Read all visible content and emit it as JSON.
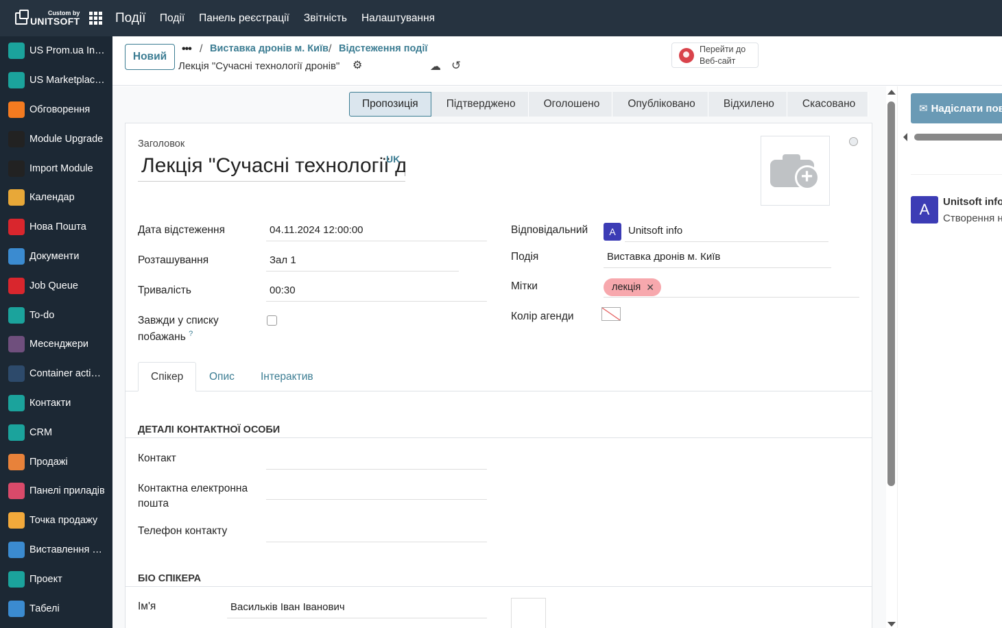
{
  "brand": {
    "small": "Custom by",
    "big": "UNITSOFT"
  },
  "navbar": {
    "app_title": "Події",
    "menu": [
      "Події",
      "Панель реєстрації",
      "Звітність",
      "Налаштування"
    ]
  },
  "sidebar": {
    "items": [
      {
        "label": "US Prom.ua Inte...",
        "icon": "cube-icon",
        "color": "#1ba39c"
      },
      {
        "label": "US Marketplace...",
        "icon": "cube-icon",
        "color": "#1ba39c"
      },
      {
        "label": "Обговорення",
        "icon": "chat-bubble-icon",
        "color": "#f47b20"
      },
      {
        "label": "Module Upgrade",
        "icon": "upgrade-icon",
        "color": "#222222"
      },
      {
        "label": "Import Module",
        "icon": "import-icon",
        "color": "#222222"
      },
      {
        "label": "Календар",
        "icon": "calendar-icon",
        "color": "#e8a838"
      },
      {
        "label": "Нова Пошта",
        "icon": "nova-poshta-icon",
        "color": "#d9262d"
      },
      {
        "label": "Документи",
        "icon": "documents-icon",
        "color": "#3b8bd0"
      },
      {
        "label": "Job Queue",
        "icon": "job-queue-icon",
        "color": "#d9262d"
      },
      {
        "label": "To-do",
        "icon": "todo-icon",
        "color": "#1ba39c"
      },
      {
        "label": "Месенджери",
        "icon": "messenger-icon",
        "color": "#6f4f7d"
      },
      {
        "label": "Container actions",
        "icon": "container-icon",
        "color": "#2d4a6b"
      },
      {
        "label": "Контакти",
        "icon": "contacts-icon",
        "color": "#1ba39c"
      },
      {
        "label": "CRM",
        "icon": "crm-icon",
        "color": "#1ba39c"
      },
      {
        "label": "Продажі",
        "icon": "sales-icon",
        "color": "#e8823a"
      },
      {
        "label": "Панелі приладів",
        "icon": "dashboard-icon",
        "color": "#d94a6a"
      },
      {
        "label": "Точка продажу",
        "icon": "pos-icon",
        "color": "#f2a93b"
      },
      {
        "label": "Виставлення ра...",
        "icon": "invoice-icon",
        "color": "#3b8bd0"
      },
      {
        "label": "Проект",
        "icon": "project-icon",
        "color": "#1ba39c"
      },
      {
        "label": "Табелі",
        "icon": "timesheet-icon",
        "color": "#3b8bd0"
      }
    ]
  },
  "control": {
    "new_label": "Новий",
    "dots": "•••",
    "breadcrumb": [
      "Виставка дронів м. Київ",
      "Відстеження події"
    ],
    "current": "Лекція \"Сучасні технології дронів\"",
    "website_label_1": "Перейти до",
    "website_label_2": "Веб-сайт"
  },
  "stages": [
    "Пропозиція",
    "Підтверджено",
    "Оголошено",
    "Опубліковано",
    "Відхилено",
    "Скасовано"
  ],
  "form": {
    "title_label": "Заголовок",
    "title_value": "Лекція \"Сучасні технології дронів\"",
    "lang_badge": "UK",
    "date_label": "Дата відстеження",
    "date_value": "04.11.2024 12:00:00",
    "location_label": "Розташування",
    "location_value": "Зал 1",
    "duration_label": "Тривалість",
    "duration_value": "00:30",
    "wishlist_label_1": "Завжди у списку",
    "wishlist_label_2": "побажань",
    "help_mark": "?",
    "responsible_label": "Відповідальний",
    "responsible_avatar": "A",
    "responsible_value": "Unitsoft info",
    "event_label": "Подія",
    "event_value": "Виставка дронів м. Київ",
    "tags_label": "Мітки",
    "tag_value": "лекція",
    "agenda_color_label": "Колір агенди"
  },
  "tabs": [
    "Спікер",
    "Опис",
    "Інтерактив"
  ],
  "speaker": {
    "contact_section": "Деталі контактної особи",
    "contact_label": "Контакт",
    "email_label_1": "Контактна електронна",
    "email_label_2": "пошта",
    "phone_label": "Телефон контакту",
    "bio_section": "Біо спікера",
    "name_label": "Ім'я",
    "name_value": "Васильків Іван Іванович"
  },
  "chatter": {
    "send_label": "Надіслати повідомлення",
    "avatar": "A",
    "author": "Unitsoft info",
    "message": "Створення нового запису"
  }
}
